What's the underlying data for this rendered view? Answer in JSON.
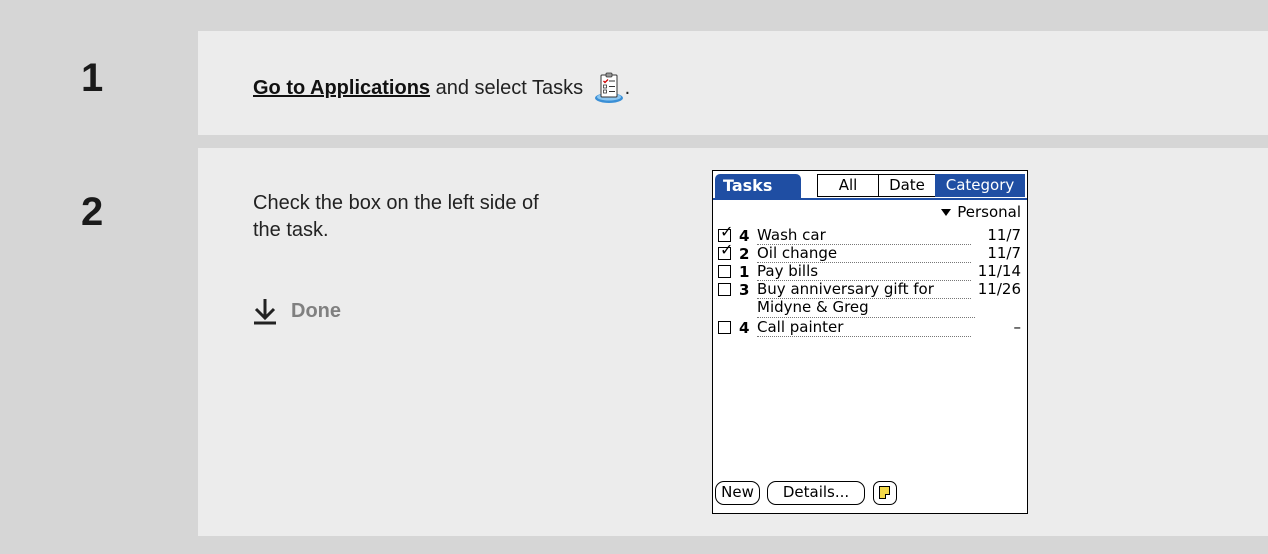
{
  "step1": {
    "number": "1",
    "link_text": "Go to Applications",
    "text": " and select Tasks ",
    "period": "."
  },
  "step2": {
    "number": "2",
    "instruction": "Check the box on the left side of the task.",
    "done_label": "Done"
  },
  "palm": {
    "title": "Tasks",
    "tabs": [
      "All",
      "Date",
      "Category"
    ],
    "selected_tab": "Category",
    "category": "Personal",
    "tasks": [
      {
        "checked": true,
        "priority": "4",
        "desc": "Wash car",
        "due": "11/7"
      },
      {
        "checked": true,
        "priority": "2",
        "desc": "Oil change",
        "due": "11/7"
      },
      {
        "checked": false,
        "priority": "1",
        "desc": "Pay bills",
        "due": "11/14"
      },
      {
        "checked": false,
        "priority": "3",
        "desc": "Buy anniversary gift for",
        "desc2": "Midyne & Greg",
        "due": "11/26"
      },
      {
        "checked": false,
        "priority": "4",
        "desc": "Call painter",
        "due": "–"
      }
    ],
    "buttons": {
      "new": "New",
      "details": "Details..."
    },
    "checkmark": "✓",
    "accent_color": "#1f4ea3"
  }
}
